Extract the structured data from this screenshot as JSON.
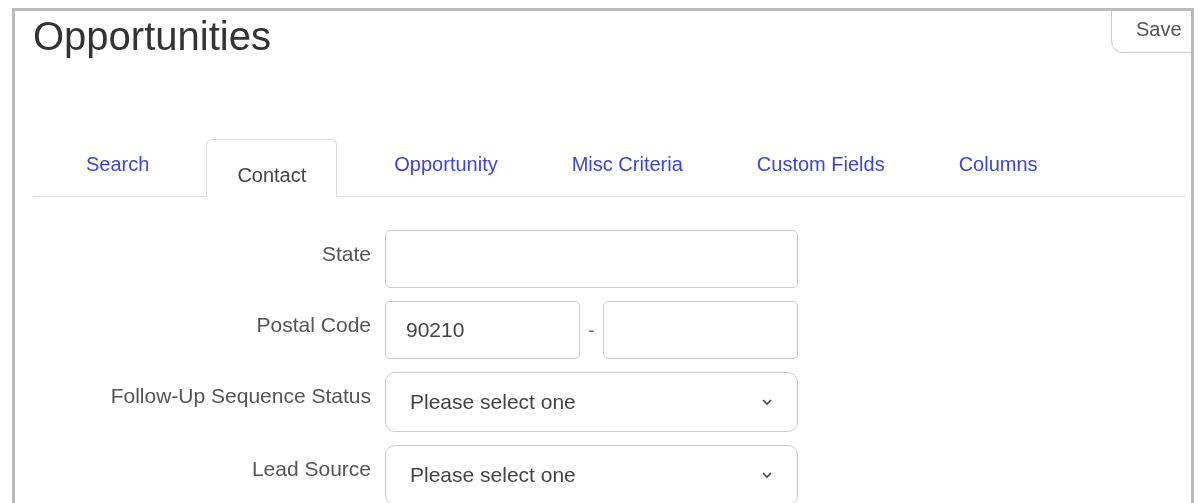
{
  "page": {
    "title": "Opportunities",
    "saved_button": "Save"
  },
  "tabs": [
    {
      "label": "Search",
      "selected": false
    },
    {
      "label": "Contact",
      "selected": true
    },
    {
      "label": "Opportunity",
      "selected": false
    },
    {
      "label": "Misc Criteria",
      "selected": false
    },
    {
      "label": "Custom Fields",
      "selected": false
    },
    {
      "label": "Columns",
      "selected": false
    }
  ],
  "fields": [
    {
      "kind": "text",
      "label": "State"
    },
    {
      "kind": "postal",
      "label": "Postal Code",
      "value": "90210",
      "separator": "-"
    },
    {
      "kind": "select",
      "label": "Follow-Up Sequence Status",
      "value": "Please select one"
    },
    {
      "kind": "select",
      "label": "Lead Source",
      "value": "Please select one"
    }
  ]
}
